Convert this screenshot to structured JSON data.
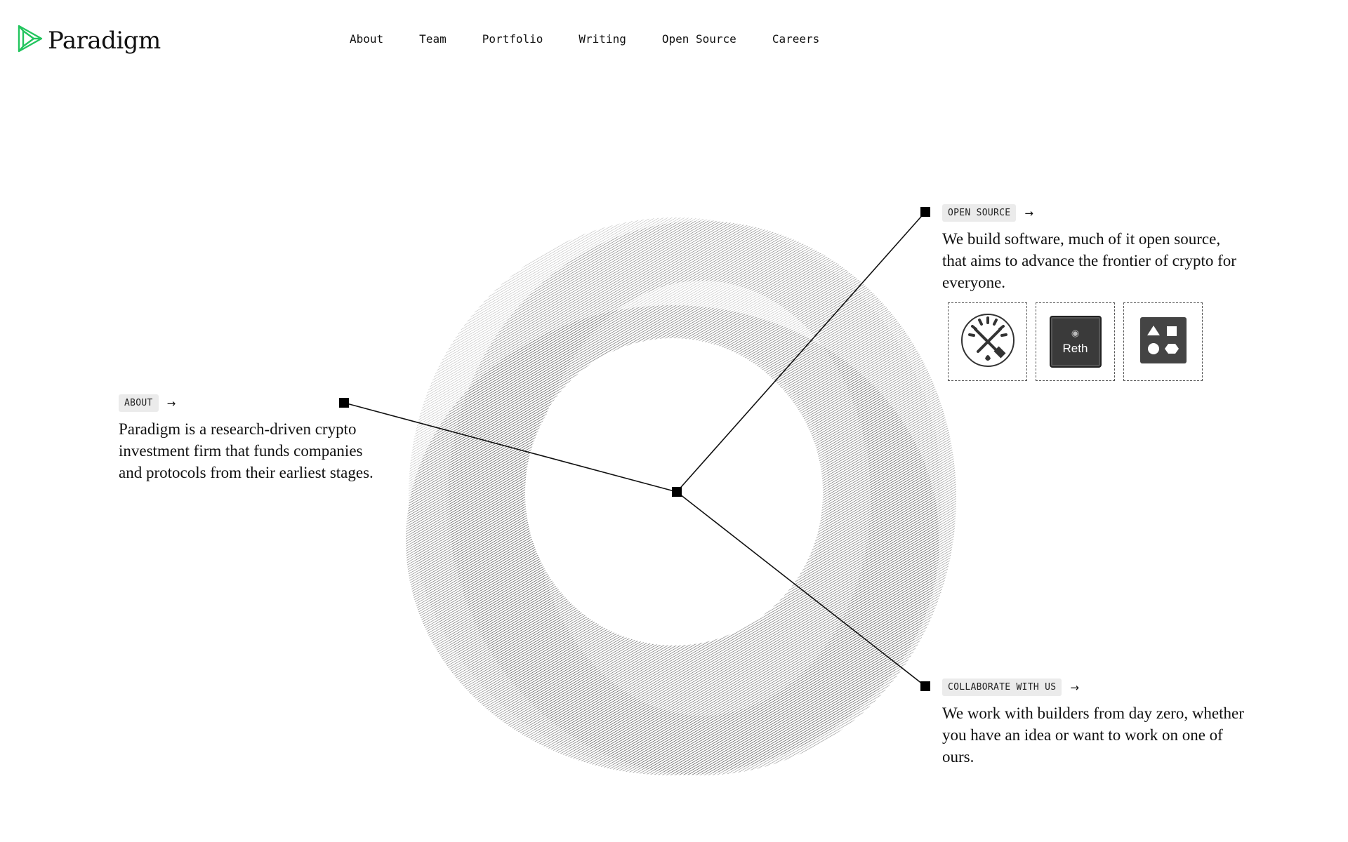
{
  "header": {
    "brand": "Paradigm",
    "brand_color": "#22c55e",
    "nav": [
      "About",
      "Team",
      "Portfolio",
      "Writing",
      "Open Source",
      "Careers"
    ]
  },
  "sections": {
    "about": {
      "tag": "ABOUT",
      "text": "Paradigm is a research-driven crypto investment firm that funds companies and protocols from their earliest stages."
    },
    "open_source": {
      "tag": "OPEN SOURCE",
      "text": "We build software, much of it open source, that aims to advance the frontier of crypto for everyone.",
      "projects": [
        {
          "icon": "foundry-icon"
        },
        {
          "icon": "reth-icon",
          "label": "Reth"
        },
        {
          "icon": "shapes-icon"
        }
      ]
    },
    "collaborate": {
      "tag": "COLLABORATE WITH US",
      "text": "We work with builders from day zero, whether you have an idea or want to work on one of ours."
    },
    "arrow": "→"
  }
}
